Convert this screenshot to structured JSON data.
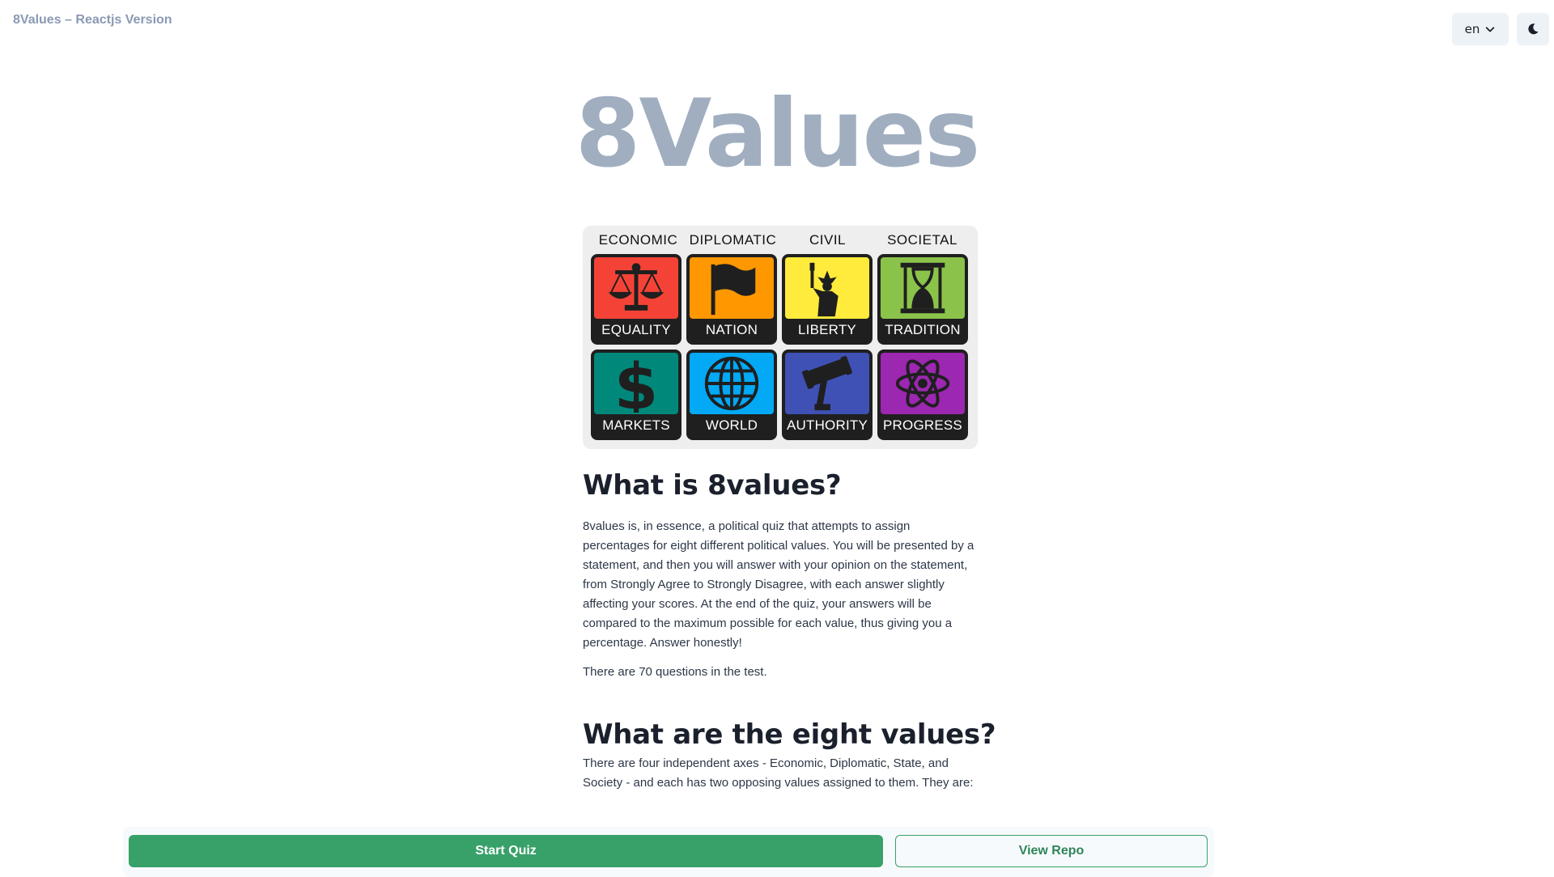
{
  "header": {
    "app_title": "8Values – Reactjs Version",
    "language": "en",
    "icons": {
      "language_chevron": "chevron-down-icon",
      "theme": "moon-icon"
    }
  },
  "hero": {
    "title": "8Values"
  },
  "values_panel": {
    "axes": [
      "ECONOMIC",
      "DIPLOMATIC",
      "CIVIL",
      "SOCIETAL"
    ],
    "tiles": [
      {
        "label": "EQUALITY",
        "color": "#f44336",
        "icon": "scales-icon"
      },
      {
        "label": "NATION",
        "color": "#ff9800",
        "icon": "flag-icon"
      },
      {
        "label": "LIBERTY",
        "color": "#ffeb3b",
        "icon": "statue-of-liberty-icon"
      },
      {
        "label": "TRADITION",
        "color": "#8bc34a",
        "icon": "hourglass-icon"
      },
      {
        "label": "MARKETS",
        "color": "#00897b",
        "icon": "dollar-icon"
      },
      {
        "label": "WORLD",
        "color": "#03a9f4",
        "icon": "globe-icon"
      },
      {
        "label": "AUTHORITY",
        "color": "#3f51b5",
        "icon": "gavel-icon"
      },
      {
        "label": "PROGRESS",
        "color": "#9c27b0",
        "icon": "atom-icon"
      }
    ]
  },
  "about": {
    "heading": "What is 8values?",
    "intro": "8values is, in essence, a political quiz that attempts to assign percentages for eight different political values. You will be presented by a statement, and then you will answer with your opinion on the statement, from Strongly Agree to Strongly Disagree, with each answer slightly affecting your scores. At the end of the quiz, your answers will be compared to the maximum possible for each value, thus giving you a percentage. Answer honestly!",
    "question_count": "There are 70 questions in the test."
  },
  "values_section": {
    "heading": "What are the eight values?",
    "intro": "There are four independent axes - Economic, Diplomatic, State, and Society - and each has two opposing values assigned to them. They are:"
  },
  "actions": {
    "start_label": "Start Quiz",
    "repo_label": "View Repo",
    "primary_color": "#38a169"
  }
}
